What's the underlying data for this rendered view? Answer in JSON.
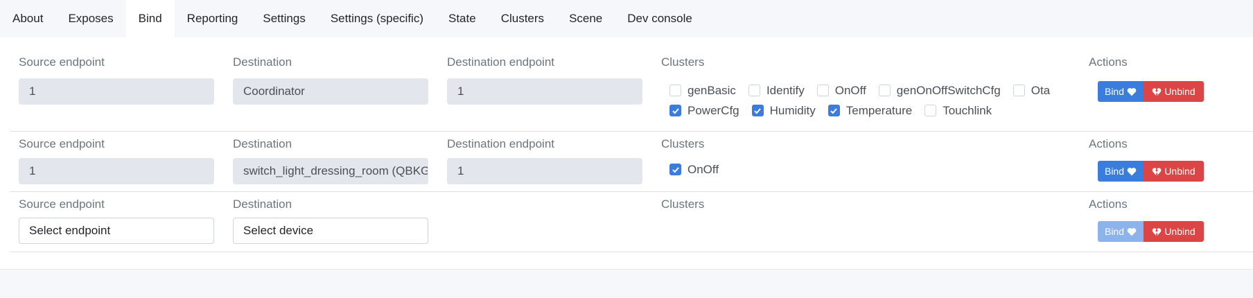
{
  "tabs": [
    {
      "label": "About",
      "active": false
    },
    {
      "label": "Exposes",
      "active": false
    },
    {
      "label": "Bind",
      "active": true
    },
    {
      "label": "Reporting",
      "active": false
    },
    {
      "label": "Settings",
      "active": false
    },
    {
      "label": "Settings (specific)",
      "active": false
    },
    {
      "label": "State",
      "active": false
    },
    {
      "label": "Clusters",
      "active": false
    },
    {
      "label": "Scene",
      "active": false
    },
    {
      "label": "Dev console",
      "active": false
    }
  ],
  "labels": {
    "source_endpoint": "Source endpoint",
    "destination": "Destination",
    "destination_endpoint": "Destination endpoint",
    "clusters": "Clusters",
    "actions": "Actions"
  },
  "buttons": {
    "bind": "Bind",
    "unbind": "Unbind"
  },
  "colors": {
    "bind": "#3b7ddd",
    "bind_disabled": "#8db3ec",
    "unbind": "#dc4545"
  },
  "rows": [
    {
      "source_endpoint": "1",
      "destination": "Coordinator",
      "destination_endpoint": "1",
      "clusters": [
        [
          {
            "name": "genBasic",
            "checked": false
          },
          {
            "name": "Identify",
            "checked": false
          },
          {
            "name": "OnOff",
            "checked": false
          },
          {
            "name": "genOnOffSwitchCfg",
            "checked": false
          },
          {
            "name": "Ota",
            "checked": false
          }
        ],
        [
          {
            "name": "PowerCfg",
            "checked": true
          },
          {
            "name": "Humidity",
            "checked": true
          },
          {
            "name": "Temperature",
            "checked": true
          },
          {
            "name": "Touchlink",
            "checked": false
          }
        ]
      ],
      "bind_disabled": false
    },
    {
      "source_endpoint": "1",
      "destination": "switch_light_dressing_room (QBKG",
      "destination_endpoint": "1",
      "clusters": [
        [
          {
            "name": "OnOff",
            "checked": true
          }
        ]
      ],
      "bind_disabled": false
    },
    {
      "source_endpoint_placeholder": "Select endpoint",
      "destination_placeholder": "Select device",
      "bind_disabled": true
    }
  ]
}
